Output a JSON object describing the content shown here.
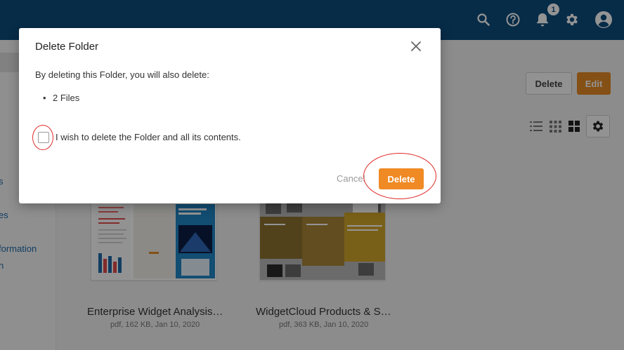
{
  "topbar": {
    "icons": [
      "search-icon",
      "help-icon",
      "bell-icon",
      "gear-icon",
      "account-icon"
    ],
    "notification_count": "1",
    "color": "#0d4c7d"
  },
  "sidebar": {
    "items": [
      "s",
      "es",
      "formation",
      "n"
    ]
  },
  "toolbar": {
    "delete_label": "Delete",
    "edit_label": "Edit",
    "view_icons": [
      "list-view-icon",
      "small-grid-view-icon",
      "grid-view-icon",
      "settings-gear-icon"
    ]
  },
  "files": [
    {
      "name": "Enterprise Widget Analysis…",
      "meta": "pdf, 162 KB, Jan 10, 2020"
    },
    {
      "name": "WidgetCloud Products & S…",
      "meta": "pdf, 363 KB, Jan 10, 2020"
    }
  ],
  "dialog": {
    "title": "Delete Folder",
    "message": "By deleting this Folder, you will also delete:",
    "items": [
      "2 Files"
    ],
    "checkbox_label": "I wish to delete the Folder and all its contents.",
    "checkbox_checked": false,
    "cancel_label": "Cancel",
    "delete_label": "Delete",
    "accent": "#f08a24",
    "highlight": "#e02b2b"
  }
}
